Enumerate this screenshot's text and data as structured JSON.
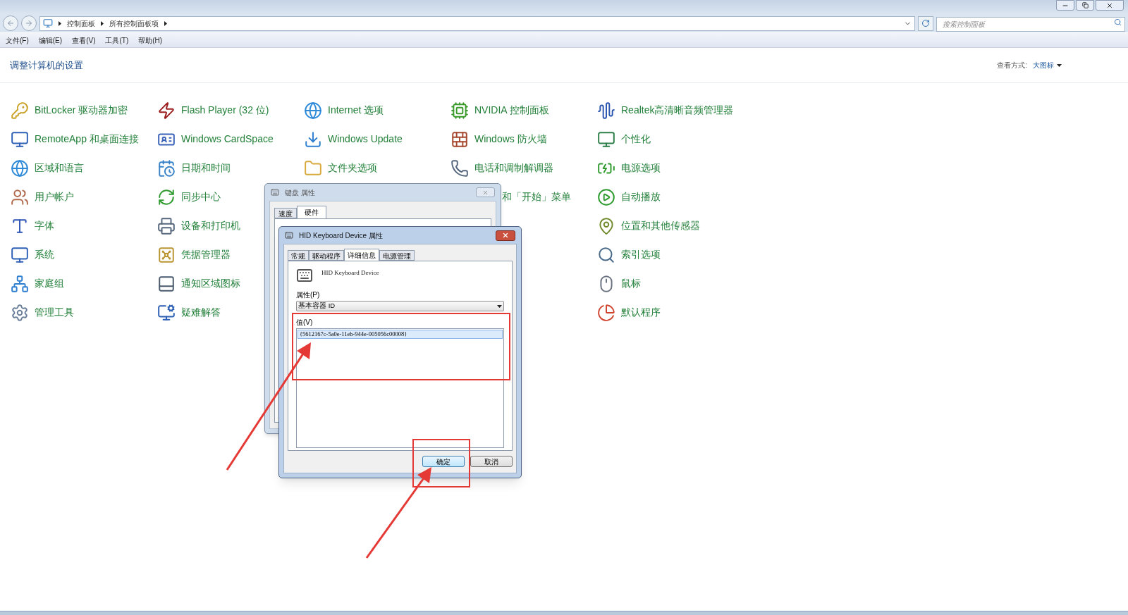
{
  "address_bar": {
    "breadcrumbs": [
      "控制面板",
      "所有控制面板项"
    ]
  },
  "search": {
    "placeholder": "搜索控制面板"
  },
  "menu": [
    "文件(F)",
    "编辑(E)",
    "查看(V)",
    "工具(T)",
    "帮助(H)"
  ],
  "header": {
    "title": "调整计算机的设置",
    "view_label": "查看方式:",
    "view_value": "大图标"
  },
  "columns": [
    [
      {
        "label": "BitLocker 驱动器加密",
        "kind": "item"
      },
      {
        "label": "RemoteApp 和桌面连接",
        "kind": "item"
      },
      {
        "label": "区域和语言",
        "kind": "item"
      },
      {
        "label": "用户帐户",
        "kind": "item"
      },
      {
        "label": "字体",
        "kind": "item"
      },
      {
        "label": "系统",
        "kind": "item"
      },
      {
        "label": "家庭组",
        "kind": "item"
      },
      {
        "label": "管理工具",
        "kind": "item"
      }
    ],
    [
      {
        "label": "Flash Player (32 位)",
        "kind": "item"
      },
      {
        "label": "Windows CardSpace",
        "kind": "item"
      },
      {
        "label": "日期和时间",
        "kind": "item"
      },
      {
        "label": "同步中心",
        "kind": "item"
      },
      {
        "label": "设备和打印机",
        "kind": "item"
      },
      {
        "label": "凭据管理器",
        "kind": "item"
      },
      {
        "label": "通知区域图标",
        "kind": "item"
      },
      {
        "label": "疑难解答",
        "kind": "item"
      }
    ],
    [
      {
        "label": "Internet 选项",
        "kind": "item"
      },
      {
        "label": "Windows Update",
        "kind": "item"
      },
      {
        "label": "文件夹选项",
        "kind": "item"
      }
    ],
    [
      {
        "label": "NVIDIA 控制面板",
        "kind": "item"
      },
      {
        "label": "Windows 防火墙",
        "kind": "item"
      },
      {
        "label": "电话和调制解调器",
        "kind": "item"
      },
      {
        "label": "和「开始」菜单",
        "kind": "partial"
      }
    ],
    [
      {
        "label": "Realtek高清晰音频管理器",
        "kind": "item"
      },
      {
        "label": "个性化",
        "kind": "item"
      },
      {
        "label": "电源选项",
        "kind": "item"
      },
      {
        "label": "自动播放",
        "kind": "item"
      },
      {
        "label": "位置和其他传感器",
        "kind": "item"
      },
      {
        "label": "索引选项",
        "kind": "item"
      },
      {
        "label": "鼠标",
        "kind": "item"
      },
      {
        "label": "默认程序",
        "kind": "item"
      }
    ]
  ],
  "keyboard_dialog": {
    "title": "键盘 属性",
    "tabs": [
      {
        "label": "速度",
        "selected": false
      },
      {
        "label": "硬件",
        "selected": true
      }
    ]
  },
  "device_dialog": {
    "title": "HID Keyboard Device 属性",
    "tabs": [
      {
        "label": "常规",
        "selected": false
      },
      {
        "label": "驱动程序",
        "selected": false
      },
      {
        "label": "详细信息",
        "selected": true
      },
      {
        "label": "电源管理",
        "selected": false
      }
    ],
    "device_name": "HID Keyboard Device",
    "property_label": "属性(P)",
    "property_value": "基本容器 ID",
    "value_label": "值(V)",
    "values": [
      {
        "text": "{5612167c-5a0e-11eb-944e-005056c00008}",
        "selected": true
      }
    ],
    "buttons": [
      {
        "label": "确定",
        "default": true
      },
      {
        "label": "取消",
        "default": false
      }
    ]
  }
}
